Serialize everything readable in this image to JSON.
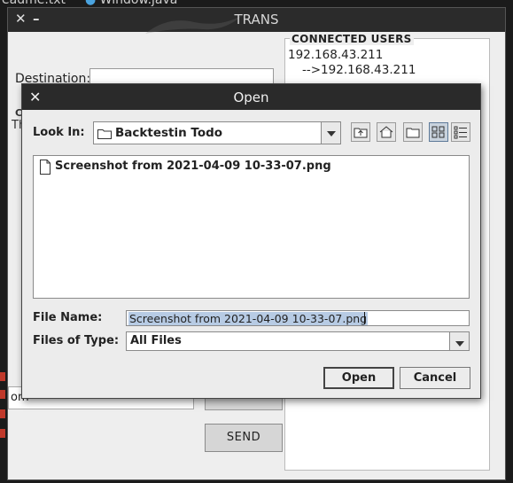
{
  "background": {
    "tab1_label": "eadme.txt",
    "tab2_label": "Window.java"
  },
  "trans_window": {
    "title": "TRANS",
    "destination_label": "Destination:",
    "left_stub_text": "Th",
    "left_stub_c": "C",
    "message_text": "om",
    "send_label": "SEND",
    "connected_users": {
      "title": "CONNECTED USERS",
      "entries": [
        "192.168.43.211",
        "-->192.168.43.211"
      ]
    }
  },
  "open_dialog": {
    "title": "Open",
    "look_in_label": "Look In:",
    "look_in_value": "Backtestin Todo",
    "toolbar_icons": [
      "up-folder-icon",
      "home-icon",
      "new-folder-icon",
      "list-view-icon",
      "details-view-icon"
    ],
    "files": [
      "Screenshot from 2021-04-09 10-33-07.png"
    ],
    "file_name_label": "File Name:",
    "file_name_value": "Screenshot from 2021-04-09 10-33-07.png",
    "files_of_type_label": "Files of Type:",
    "files_of_type_value": "All Files",
    "open_label": "Open",
    "cancel_label": "Cancel"
  },
  "colors": {
    "titlebar": "#2a2a2a",
    "selection": "#b7cbe4",
    "panel": "#eeeeee"
  }
}
